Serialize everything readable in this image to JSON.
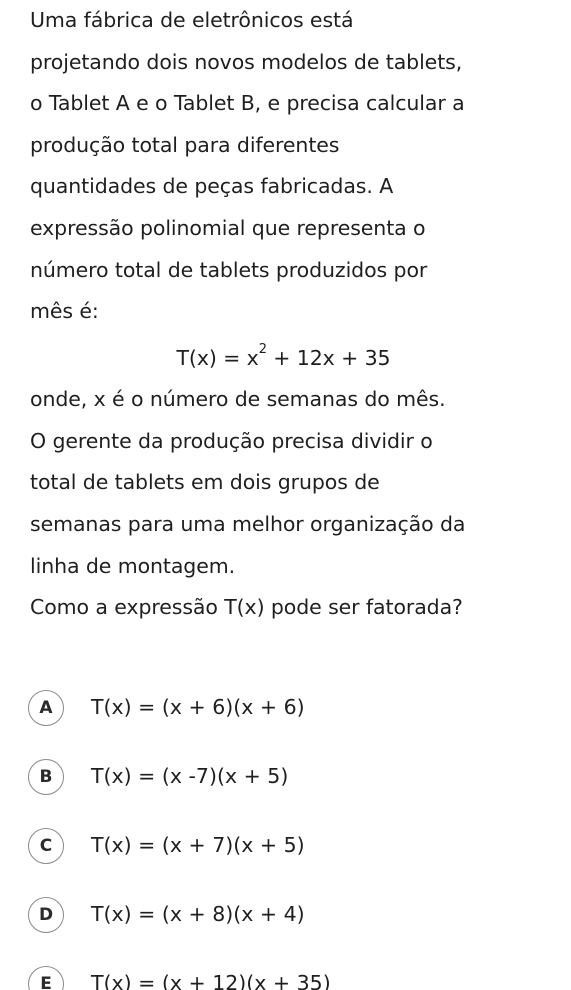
{
  "question": {
    "lines": [
      "Uma fábrica de eletrônicos está",
      "projetando dois novos modelos de tablets,",
      "o Tablet A e o Tablet B, e precisa calcular a",
      "produção total para diferentes",
      "quantidades de peças fabricadas. A",
      "expressão polinomial que representa o",
      "número total de tablets produzidos por",
      "mês é:"
    ],
    "formula_lhs": "T(x) = x",
    "formula_exp": "2",
    "formula_rhs": " + 12x + 35",
    "after_lines": [
      "onde, x é o número de semanas do mês.",
      "O gerente da produção precisa dividir o",
      "total de tablets em dois grupos de",
      "semanas para uma melhor organização da",
      "linha de montagem.",
      "Como a expressão T(x) pode ser fatorada?"
    ]
  },
  "options": [
    {
      "letter": "A",
      "text": "T(x) = (x + 6)(x + 6)"
    },
    {
      "letter": "B",
      "text": "T(x) = (x -7)(x + 5)"
    },
    {
      "letter": "C",
      "text": "T(x) = (x + 7)(x + 5)"
    },
    {
      "letter": "D",
      "text": "T(x) = (x + 8)(x + 4)"
    },
    {
      "letter": "E",
      "text": "T(x) = (x + 12)(x + 35)"
    }
  ]
}
